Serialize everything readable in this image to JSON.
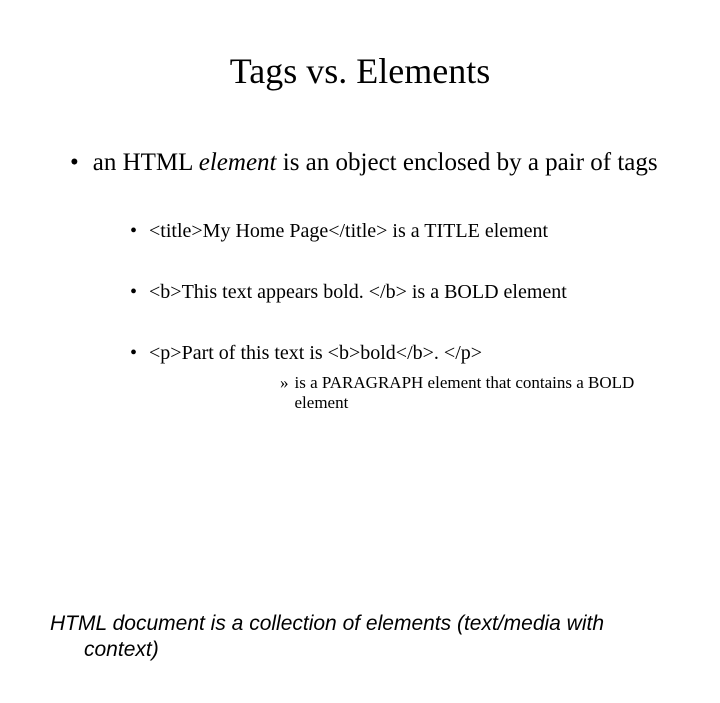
{
  "title": "Tags vs. Elements",
  "main": {
    "pre": "an HTML ",
    "mid": "element",
    "post": " is an object enclosed by a pair of tags"
  },
  "subs": [
    "<title>My Home Page</title> is a TITLE element",
    "<b>This text appears bold. </b> is a BOLD element",
    "<p>Part of this text is <b>bold</b>. </p>"
  ],
  "subsub": "is a PARAGRAPH element that contains a BOLD element",
  "footer": "HTML document is a collection of elements (text/media with context)",
  "glyphs": {
    "bullet": "•",
    "raquo": "»"
  }
}
